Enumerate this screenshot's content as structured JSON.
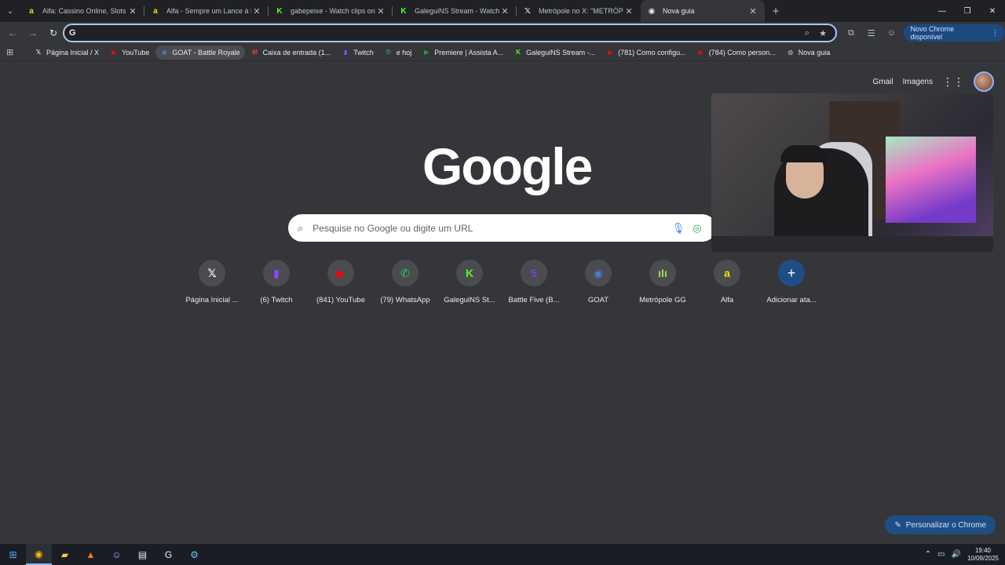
{
  "tabs": [
    {
      "title": "Alfa: Cassino Online, Slots e Jogos",
      "favicon": "alfa-icon",
      "color": "#f5e000",
      "glyph": "a"
    },
    {
      "title": "Alfa - Sempre um Lance à Frente",
      "favicon": "alfa-icon",
      "color": "#f5e000",
      "glyph": "a"
    },
    {
      "title": "gabepeixe - Watch clips on Kick",
      "favicon": "kick-icon",
      "color": "#53fc18",
      "glyph": "K"
    },
    {
      "title": "GaleguiNS Stream - Watch Live",
      "favicon": "kick-icon",
      "color": "#53fc18",
      "glyph": "K"
    },
    {
      "title": "Metrópole no X: \"METRÓPOLE",
      "favicon": "x-icon",
      "color": "#e8eaed",
      "glyph": "𝕏"
    },
    {
      "title": "Nova guia",
      "favicon": "chrome-icon",
      "color": "#e8eaed",
      "glyph": "◉"
    }
  ],
  "omnibox": {
    "value": "",
    "placeholder": ""
  },
  "chrome_update": "Novo Chrome disponível",
  "bookmarks": [
    {
      "label": "Página Inicial / X",
      "glyph": "𝕏",
      "color": "#e8eaed"
    },
    {
      "label": "YouTube",
      "glyph": "▶",
      "color": "#ff0000"
    },
    {
      "label": "GOAT - Battle Royale",
      "glyph": "◉",
      "color": "#4a7bd6"
    },
    {
      "label": "Caixa de entrada (1...",
      "glyph": "M",
      "color": "#ea4335"
    },
    {
      "label": "Twitch",
      "glyph": "▮",
      "color": "#9146ff"
    },
    {
      "label": "e hoj",
      "glyph": "✆",
      "color": "#25d366"
    },
    {
      "label": "Premiere | Assista A...",
      "glyph": "▶",
      "color": "#19a83a"
    },
    {
      "label": "GaleguiNS Stream -...",
      "glyph": "K",
      "color": "#53fc18"
    },
    {
      "label": "(781) Como configu...",
      "glyph": "▶",
      "color": "#ff0000"
    },
    {
      "label": "(784) Como person...",
      "glyph": "▶",
      "color": "#ff0000"
    },
    {
      "label": "Nova guia",
      "glyph": "◍",
      "color": "#bdc1c6"
    }
  ],
  "top_links": {
    "gmail": "Gmail",
    "images": "Imagens"
  },
  "logo": "Google",
  "search": {
    "placeholder": "Pesquise no Google ou digite um URL"
  },
  "shortcuts": [
    {
      "label": "Página Inicial ...",
      "glyph": "𝕏",
      "color": "#ffffff"
    },
    {
      "label": "(6) Twitch",
      "glyph": "▮",
      "color": "#9146ff"
    },
    {
      "label": "(841) YouTube",
      "glyph": "▶",
      "color": "#ff0000"
    },
    {
      "label": "(79) WhatsApp",
      "glyph": "✆",
      "color": "#25d366"
    },
    {
      "label": "GaleguiNS St...",
      "glyph": "K",
      "color": "#53fc18"
    },
    {
      "label": "Battle Five (B...",
      "glyph": "5",
      "color": "#7b3fe4"
    },
    {
      "label": "GOAT",
      "glyph": "◉",
      "color": "#4a7bd6"
    },
    {
      "label": "Metrópole GG",
      "glyph": "ıIı",
      "color": "#9be44a"
    },
    {
      "label": "Alfa",
      "glyph": "a",
      "color": "#f5e000"
    }
  ],
  "add_shortcut": "Adicionar ata...",
  "personalize": "Personalizar o Chrome",
  "clock": {
    "time": "19:40",
    "date": "10/09/2025"
  },
  "colors": {
    "accent": "#8ab4f8",
    "background": "#35363a",
    "tabbar": "#202124"
  }
}
